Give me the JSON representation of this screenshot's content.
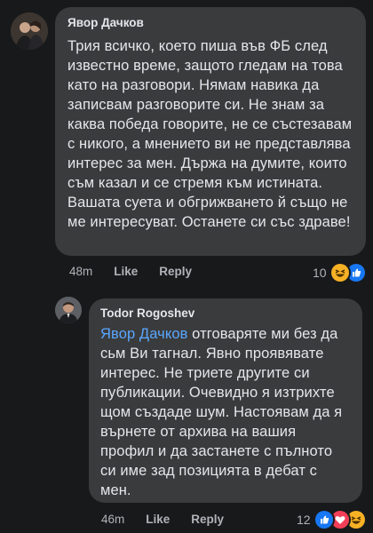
{
  "comment1": {
    "author": "Явор Дачков",
    "text": "Трия всичко, което пиша във ФБ след известно време, защото гледам на това като на разговори. Нямам навика да записвам разговорите си. Не знам за каква победа говорите, не се състезавам с никого, а мнението ви не представлява интерес за мен. Държа на думите, които съм казал и се стремя към истината. Вашата суета и обгрижването й също не ме интересуват. Останете си със здраве!",
    "time": "48m",
    "like_label": "Like",
    "reply_label": "Reply",
    "reaction_count": "10",
    "reactions": [
      "haha-icon",
      "like-icon"
    ]
  },
  "comment2": {
    "author": "Todor Rogoshev",
    "mention": "Явор Дачков",
    "text": " отговаряте ми без да сьм Ви тагнал. Явно проявявате интерес. Не триете другите си публикации. Очевидно я изтрихте щом създаде шум. Настоявам да я върнете от архива на вашия профил и да застанете с пълното си име зад позицията в дебат с мен.",
    "time": "46m",
    "like_label": "Like",
    "reply_label": "Reply",
    "reaction_count": "12",
    "reactions": [
      "like-icon",
      "love-icon",
      "haha-icon"
    ]
  },
  "colors": {
    "background": "#18191a",
    "bubble": "#3a3b3c",
    "text": "#e4e6eb",
    "secondary": "#b0b3b8",
    "mention": "#5aa7ff",
    "like_blue": "#1877f2",
    "love_red": "#f33e58",
    "haha_yellow": "#f7b125"
  }
}
